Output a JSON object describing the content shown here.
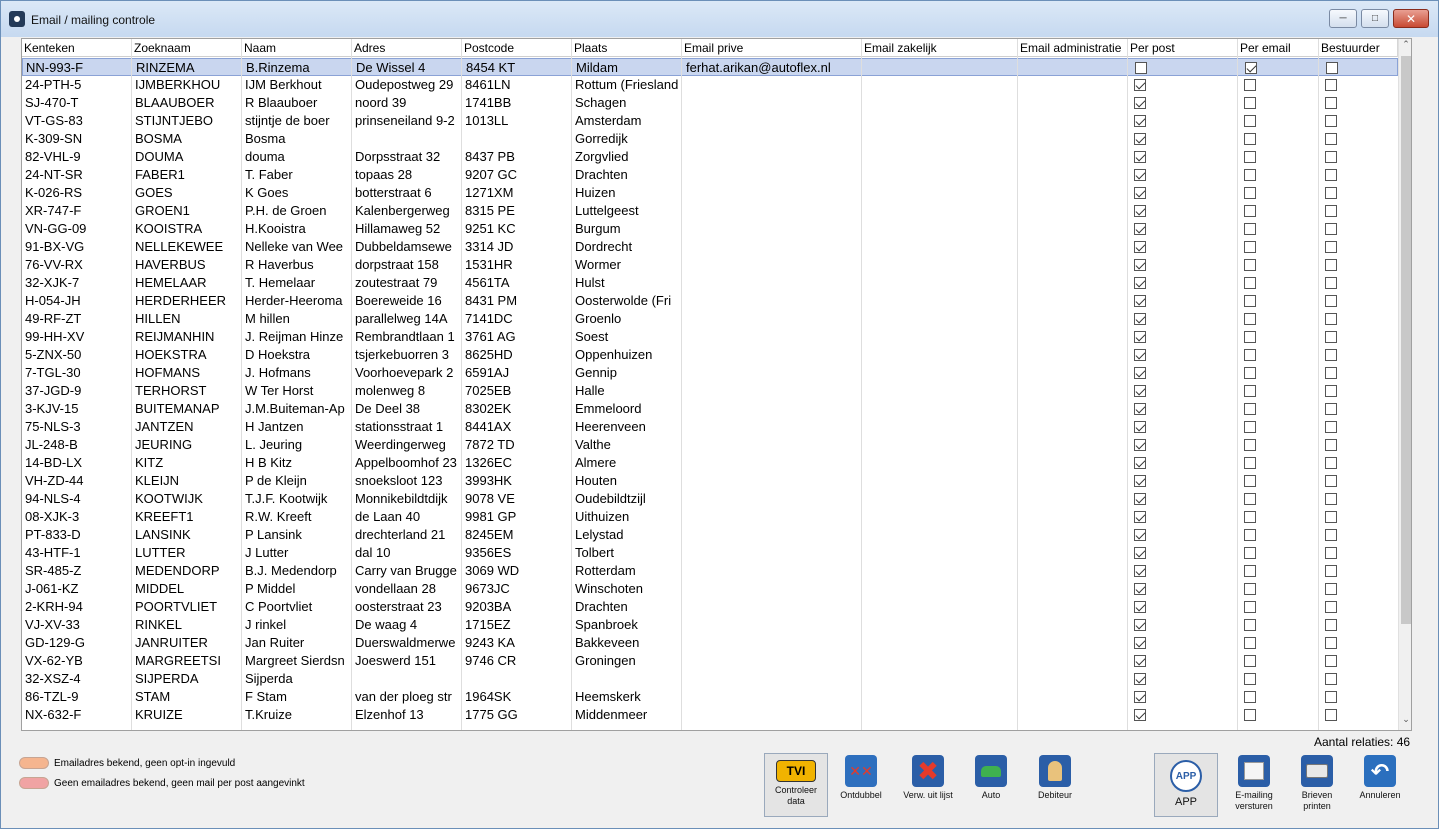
{
  "window": {
    "title": "Email / mailing controle"
  },
  "columns": [
    "Kenteken",
    "Zoeknaam",
    "Naam",
    "Adres",
    "Postcode",
    "Plaats",
    "Email prive",
    "Email zakelijk",
    "Email administratie",
    "Per post",
    "Per email",
    "Bestuurder"
  ],
  "rows": [
    {
      "kenteken": "NN-993-F",
      "zoeknaam": "RINZEMA",
      "naam": "B.Rinzema",
      "adres": "De Wissel 4",
      "postcode": "8454 KT",
      "plaats": "Mildam",
      "email_prive": "ferhat.arikan@autoflex.nl",
      "per_post": false,
      "per_email": true,
      "bestuurder": false
    },
    {
      "kenteken": "24-PTH-5",
      "zoeknaam": "IJMBERKHOU",
      "naam": "IJM Berkhout",
      "adres": "Oudepostweg 29",
      "postcode": "8461LN",
      "plaats": "Rottum (Friesland",
      "email_prive": "",
      "per_post": true,
      "per_email": false,
      "bestuurder": false
    },
    {
      "kenteken": "SJ-470-T",
      "zoeknaam": "BLAAUBOER",
      "naam": "R Blaauboer",
      "adres": "noord 39",
      "postcode": "1741BB",
      "plaats": "Schagen",
      "email_prive": "",
      "per_post": true,
      "per_email": false,
      "bestuurder": false
    },
    {
      "kenteken": "VT-GS-83",
      "zoeknaam": "STIJNTJEBO",
      "naam": "stijntje de boer",
      "adres": "prinseneiland 9-2",
      "postcode": "1013LL",
      "plaats": "Amsterdam",
      "email_prive": "",
      "per_post": true,
      "per_email": false,
      "bestuurder": false
    },
    {
      "kenteken": "K-309-SN",
      "zoeknaam": "BOSMA",
      "naam": "Bosma",
      "adres": "",
      "postcode": "",
      "plaats": "Gorredijk",
      "email_prive": "",
      "per_post": true,
      "per_email": false,
      "bestuurder": false
    },
    {
      "kenteken": "82-VHL-9",
      "zoeknaam": "DOUMA",
      "naam": "douma",
      "adres": "Dorpsstraat 32",
      "postcode": "8437 PB",
      "plaats": "Zorgvlied",
      "email_prive": "",
      "per_post": true,
      "per_email": false,
      "bestuurder": false
    },
    {
      "kenteken": "24-NT-SR",
      "zoeknaam": "FABER1",
      "naam": "T. Faber",
      "adres": "topaas 28",
      "postcode": "9207 GC",
      "plaats": "Drachten",
      "email_prive": "",
      "per_post": true,
      "per_email": false,
      "bestuurder": false
    },
    {
      "kenteken": "K-026-RS",
      "zoeknaam": "GOES",
      "naam": "K Goes",
      "adres": "botterstraat 6",
      "postcode": "1271XM",
      "plaats": "Huizen",
      "email_prive": "",
      "per_post": true,
      "per_email": false,
      "bestuurder": false
    },
    {
      "kenteken": "XR-747-F",
      "zoeknaam": "GROEN1",
      "naam": "P.H. de Groen",
      "adres": "Kalenbergerweg",
      "postcode": "8315 PE",
      "plaats": "Luttelgeest",
      "email_prive": "",
      "per_post": true,
      "per_email": false,
      "bestuurder": false
    },
    {
      "kenteken": "VN-GG-09",
      "zoeknaam": "KOOISTRA",
      "naam": "H.Kooistra",
      "adres": "Hillamaweg 52",
      "postcode": "9251 KC",
      "plaats": "Burgum",
      "email_prive": "",
      "per_post": true,
      "per_email": false,
      "bestuurder": false
    },
    {
      "kenteken": "91-BX-VG",
      "zoeknaam": "NELLEKEWEE",
      "naam": "Nelleke van Wee",
      "adres": "Dubbeldamsewe",
      "postcode": "3314 JD",
      "plaats": "Dordrecht",
      "email_prive": "",
      "per_post": true,
      "per_email": false,
      "bestuurder": false
    },
    {
      "kenteken": "76-VV-RX",
      "zoeknaam": "HAVERBUS",
      "naam": "R Haverbus",
      "adres": "dorpstraat 158",
      "postcode": "1531HR",
      "plaats": "Wormer",
      "email_prive": "",
      "per_post": true,
      "per_email": false,
      "bestuurder": false
    },
    {
      "kenteken": "32-XJK-7",
      "zoeknaam": "HEMELAAR",
      "naam": "T. Hemelaar",
      "adres": "zoutestraat 79",
      "postcode": "4561TA",
      "plaats": "Hulst",
      "email_prive": "",
      "per_post": true,
      "per_email": false,
      "bestuurder": false
    },
    {
      "kenteken": "H-054-JH",
      "zoeknaam": "HERDERHEER",
      "naam": "Herder-Heeroma",
      "adres": "Boereweide 16",
      "postcode": "8431 PM",
      "plaats": "Oosterwolde (Fri",
      "email_prive": "",
      "per_post": true,
      "per_email": false,
      "bestuurder": false
    },
    {
      "kenteken": "49-RF-ZT",
      "zoeknaam": "HILLEN",
      "naam": "M hillen",
      "adres": "parallelweg 14A",
      "postcode": "7141DC",
      "plaats": "Groenlo",
      "email_prive": "",
      "per_post": true,
      "per_email": false,
      "bestuurder": false
    },
    {
      "kenteken": "99-HH-XV",
      "zoeknaam": "REIJMANHIN",
      "naam": "J. Reijman Hinze",
      "adres": "Rembrandtlaan 1",
      "postcode": "3761 AG",
      "plaats": "Soest",
      "email_prive": "",
      "per_post": true,
      "per_email": false,
      "bestuurder": false
    },
    {
      "kenteken": "5-ZNX-50",
      "zoeknaam": "HOEKSTRA",
      "naam": "D Hoekstra",
      "adres": "tsjerkebuorren 3",
      "postcode": "8625HD",
      "plaats": "Oppenhuizen",
      "email_prive": "",
      "per_post": true,
      "per_email": false,
      "bestuurder": false
    },
    {
      "kenteken": "7-TGL-30",
      "zoeknaam": "HOFMANS",
      "naam": "J. Hofmans",
      "adres": "Voorhoevepark 2",
      "postcode": "6591AJ",
      "plaats": "Gennip",
      "email_prive": "",
      "per_post": true,
      "per_email": false,
      "bestuurder": false
    },
    {
      "kenteken": "37-JGD-9",
      "zoeknaam": "TERHORST",
      "naam": "W Ter Horst",
      "adres": "molenweg 8",
      "postcode": "7025EB",
      "plaats": "Halle",
      "email_prive": "",
      "per_post": true,
      "per_email": false,
      "bestuurder": false
    },
    {
      "kenteken": "3-KJV-15",
      "zoeknaam": "BUITEMANAP",
      "naam": "J.M.Buiteman-Ap",
      "adres": "De Deel 38",
      "postcode": "8302EK",
      "plaats": "Emmeloord",
      "email_prive": "",
      "per_post": true,
      "per_email": false,
      "bestuurder": false
    },
    {
      "kenteken": "75-NLS-3",
      "zoeknaam": "JANTZEN",
      "naam": "H Jantzen",
      "adres": "stationsstraat 1",
      "postcode": "8441AX",
      "plaats": "Heerenveen",
      "email_prive": "",
      "per_post": true,
      "per_email": false,
      "bestuurder": false
    },
    {
      "kenteken": "JL-248-B",
      "zoeknaam": "JEURING",
      "naam": "L. Jeuring",
      "adres": "Weerdingerweg",
      "postcode": "7872 TD",
      "plaats": "Valthe",
      "email_prive": "",
      "per_post": true,
      "per_email": false,
      "bestuurder": false
    },
    {
      "kenteken": "14-BD-LX",
      "zoeknaam": "KITZ",
      "naam": "H B Kitz",
      "adres": "Appelboomhof 23",
      "postcode": "1326EC",
      "plaats": "Almere",
      "email_prive": "",
      "per_post": true,
      "per_email": false,
      "bestuurder": false
    },
    {
      "kenteken": "VH-ZD-44",
      "zoeknaam": "KLEIJN",
      "naam": "P de Kleijn",
      "adres": "snoeksloot 123",
      "postcode": "3993HK",
      "plaats": "Houten",
      "email_prive": "",
      "per_post": true,
      "per_email": false,
      "bestuurder": false
    },
    {
      "kenteken": "94-NLS-4",
      "zoeknaam": "KOOTWIJK",
      "naam": "T.J.F. Kootwijk",
      "adres": "Monnikebildtdijk",
      "postcode": "9078 VE",
      "plaats": "Oudebildtzijl",
      "email_prive": "",
      "per_post": true,
      "per_email": false,
      "bestuurder": false
    },
    {
      "kenteken": "08-XJK-3",
      "zoeknaam": "KREEFT1",
      "naam": "R.W. Kreeft",
      "adres": "de Laan 40",
      "postcode": "9981 GP",
      "plaats": "Uithuizen",
      "email_prive": "",
      "per_post": true,
      "per_email": false,
      "bestuurder": false
    },
    {
      "kenteken": "PT-833-D",
      "zoeknaam": "LANSINK",
      "naam": "P Lansink",
      "adres": "drechterland 21",
      "postcode": "8245EM",
      "plaats": "Lelystad",
      "email_prive": "",
      "per_post": true,
      "per_email": false,
      "bestuurder": false
    },
    {
      "kenteken": "43-HTF-1",
      "zoeknaam": "LUTTER",
      "naam": "J Lutter",
      "adres": "dal 10",
      "postcode": "9356ES",
      "plaats": "Tolbert",
      "email_prive": "",
      "per_post": true,
      "per_email": false,
      "bestuurder": false
    },
    {
      "kenteken": "SR-485-Z",
      "zoeknaam": "MEDENDORP",
      "naam": "B.J. Medendorp",
      "adres": "Carry van Brugge",
      "postcode": "3069 WD",
      "plaats": "Rotterdam",
      "email_prive": "",
      "per_post": true,
      "per_email": false,
      "bestuurder": false
    },
    {
      "kenteken": "J-061-KZ",
      "zoeknaam": "MIDDEL",
      "naam": "P Middel",
      "adres": "vondellaan 28",
      "postcode": "9673JC",
      "plaats": "Winschoten",
      "email_prive": "",
      "per_post": true,
      "per_email": false,
      "bestuurder": false
    },
    {
      "kenteken": "2-KRH-94",
      "zoeknaam": "POORTVLIET",
      "naam": "C Poortvliet",
      "adres": "oosterstraat 23",
      "postcode": "9203BA",
      "plaats": "Drachten",
      "email_prive": "",
      "per_post": true,
      "per_email": false,
      "bestuurder": false
    },
    {
      "kenteken": "VJ-XV-33",
      "zoeknaam": "RINKEL",
      "naam": "J rinkel",
      "adres": "De waag 4",
      "postcode": "1715EZ",
      "plaats": "Spanbroek",
      "email_prive": "",
      "per_post": true,
      "per_email": false,
      "bestuurder": false
    },
    {
      "kenteken": "GD-129-G",
      "zoeknaam": "JANRUITER",
      "naam": "Jan Ruiter",
      "adres": "Duerswaldmerwe",
      "postcode": "9243 KA",
      "plaats": "Bakkeveen",
      "email_prive": "",
      "per_post": true,
      "per_email": false,
      "bestuurder": false
    },
    {
      "kenteken": "VX-62-YB",
      "zoeknaam": "MARGREETSI",
      "naam": "Margreet Sierdsn",
      "adres": "Joeswerd 151",
      "postcode": "9746 CR",
      "plaats": "Groningen",
      "email_prive": "",
      "per_post": true,
      "per_email": false,
      "bestuurder": false
    },
    {
      "kenteken": "32-XSZ-4",
      "zoeknaam": "SIJPERDA",
      "naam": "Sijperda",
      "adres": "",
      "postcode": "",
      "plaats": "",
      "email_prive": "",
      "per_post": true,
      "per_email": false,
      "bestuurder": false
    },
    {
      "kenteken": "86-TZL-9",
      "zoeknaam": "STAM",
      "naam": "F Stam",
      "adres": "van der ploeg str",
      "postcode": "1964SK",
      "plaats": "Heemskerk",
      "email_prive": "",
      "per_post": true,
      "per_email": false,
      "bestuurder": false
    },
    {
      "kenteken": "NX-632-F",
      "zoeknaam": "KRUIZE",
      "naam": "T.Kruize",
      "adres": "Elzenhof 13",
      "postcode": "1775 GG",
      "plaats": "Middenmeer",
      "email_prive": "",
      "per_post": true,
      "per_email": false,
      "bestuurder": false
    }
  ],
  "footer": {
    "aantal": "Aantal relaties: 46",
    "legend": [
      {
        "label": "Emailadres bekend, geen opt-in ingevuld",
        "color": "#f5b58f"
      },
      {
        "label": "Geen emailadres bekend, geen mail per post aangevinkt",
        "color": "#f0a3a3"
      }
    ]
  },
  "toolbar": {
    "controleer": "Controleer data",
    "ontdubbel": "Ontdubbel",
    "verw": "Verw. uit lijst",
    "auto": "Auto",
    "debiteur": "Debiteur",
    "app": "APP",
    "app_icon": "APP",
    "emailing": "E-mailing versturen",
    "brieven": "Brieven printen",
    "annuleren": "Annuleren",
    "tvi": "TVI"
  }
}
